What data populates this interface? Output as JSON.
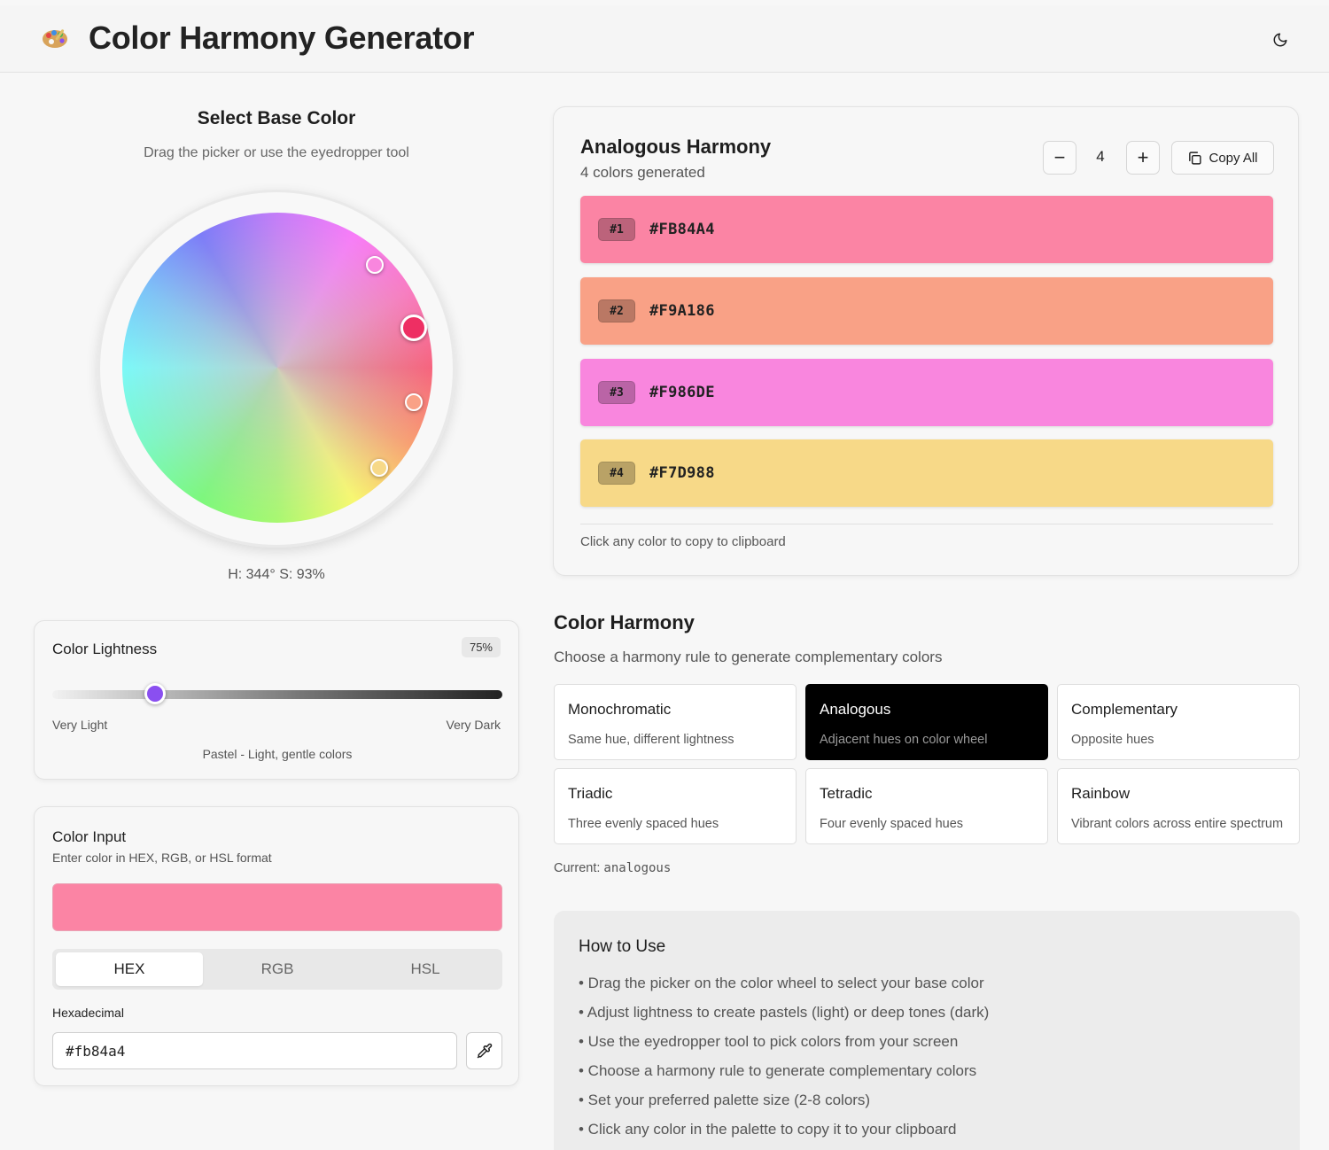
{
  "app": {
    "title": "Color Harmony Generator"
  },
  "picker": {
    "title": "Select Base Color",
    "subtitle": "Drag the picker or use the eyedropper tool",
    "readout": "H: 344° S: 93%"
  },
  "lightness": {
    "title": "Color Lightness",
    "value": "75%",
    "value_fraction": 0.75,
    "min_label": "Very Light",
    "max_label": "Very Dark",
    "description": "Pastel - Light, gentle colors"
  },
  "input": {
    "title": "Color Input",
    "subtitle": "Enter color in HEX, RGB, or HSL format",
    "preview_color": "#fb84a4",
    "tabs": [
      "HEX",
      "RGB",
      "HSL"
    ],
    "active_tab": "HEX",
    "field_label": "Hexadecimal",
    "hex_value": "#fb84a4"
  },
  "palette": {
    "title": "Analogous Harmony",
    "subtitle": "4 colors generated",
    "count": "4",
    "decrement_label": "−",
    "increment_label": "+",
    "copy_all_label": "Copy All",
    "colors": [
      {
        "index": "#1",
        "hex": "#FB84A4"
      },
      {
        "index": "#2",
        "hex": "#F9A186"
      },
      {
        "index": "#3",
        "hex": "#F986DE"
      },
      {
        "index": "#4",
        "hex": "#F7D988"
      }
    ],
    "hint": "Click any color to copy to clipboard"
  },
  "harmony": {
    "title": "Color Harmony",
    "subtitle": "Choose a harmony rule to generate complementary colors",
    "options": [
      {
        "name": "Monochromatic",
        "desc": "Same hue, different lightness"
      },
      {
        "name": "Analogous",
        "desc": "Adjacent hues on color wheel"
      },
      {
        "name": "Complementary",
        "desc": "Opposite hues"
      },
      {
        "name": "Triadic",
        "desc": "Three evenly spaced hues"
      },
      {
        "name": "Tetradic",
        "desc": "Four evenly spaced hues"
      },
      {
        "name": "Rainbow",
        "desc": "Vibrant colors across entire spectrum"
      }
    ],
    "selected": "Analogous",
    "current_label": "Current:",
    "current_value": "analogous"
  },
  "howto": {
    "title": "How to Use",
    "items": [
      "• Drag the picker on the color wheel to select your base color",
      "• Adjust lightness to create pastels (light) or deep tones (dark)",
      "• Use the eyedropper tool to pick colors from your screen",
      "• Choose a harmony rule to generate complementary colors",
      "• Set your preferred palette size (2-8 colors)",
      "• Click any color in the palette to copy it to your clipboard"
    ]
  },
  "icons": {
    "logo": "palette-icon",
    "theme": "moon-icon",
    "copy": "copy-icon",
    "eyedropper": "eyedropper-icon"
  },
  "colors": {
    "accent_purple": "#8a4ff0",
    "selected_card": "#000000"
  }
}
